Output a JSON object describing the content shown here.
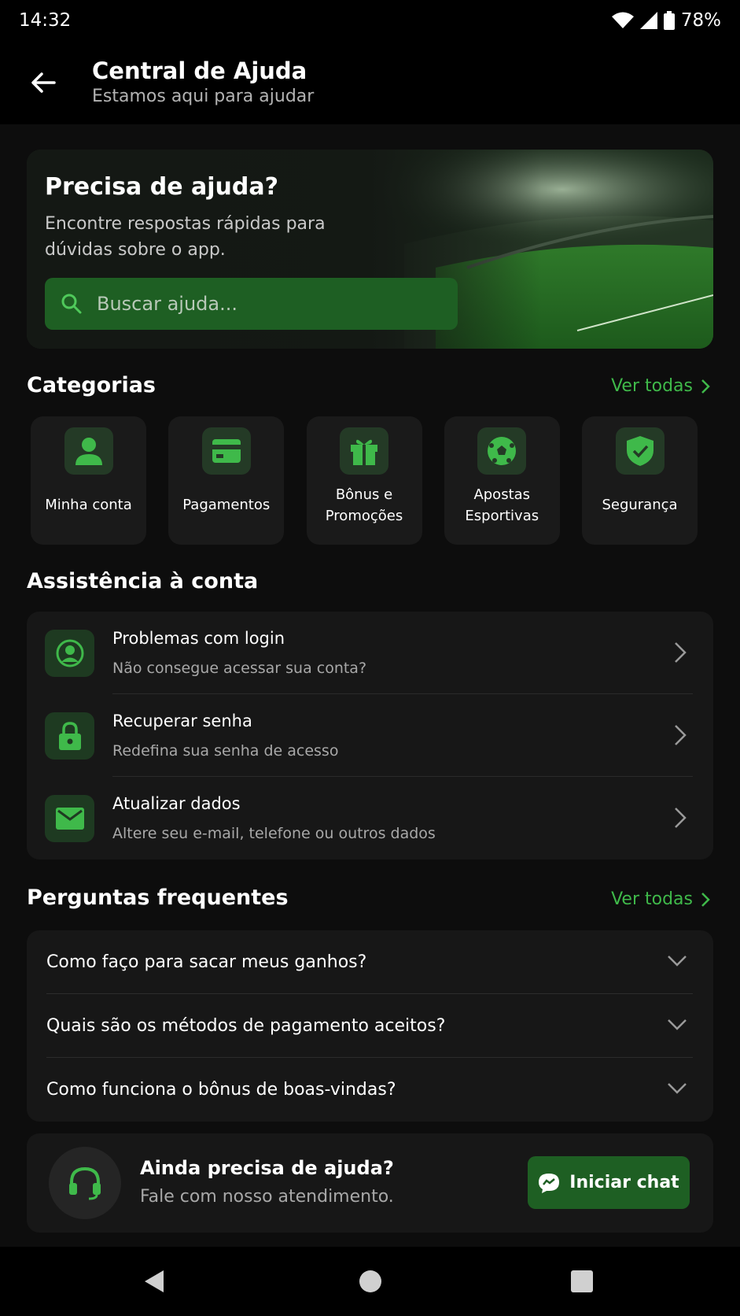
{
  "status": {
    "time": "14:32",
    "battery": "78%"
  },
  "header": {
    "title": "Central de Ajuda",
    "subtitle": "Estamos aqui para ajudar"
  },
  "hero": {
    "title": "Precisa de ajuda?",
    "text": "Encontre respostas rápidas para dúvidas sobre o app.",
    "search_placeholder": "Buscar ajuda..."
  },
  "categories": {
    "title": "Categorias",
    "see_all": "Ver todas",
    "items": [
      {
        "label": "Minha conta",
        "icon": "person-icon"
      },
      {
        "label": "Pagamentos",
        "icon": "card-icon"
      },
      {
        "label": "Bônus e Promoções",
        "icon": "gift-icon"
      },
      {
        "label": "Apostas Esportivas",
        "icon": "soccer-ball-icon"
      },
      {
        "label": "Segurança",
        "icon": "shield-check-icon"
      }
    ]
  },
  "account": {
    "title": "Assistência à conta",
    "items": [
      {
        "title": "Problemas com login",
        "subtitle": "Não consegue acessar sua conta?",
        "icon": "account-circle-icon"
      },
      {
        "title": "Recuperar senha",
        "subtitle": "Redefina sua senha de acesso",
        "icon": "lock-icon"
      },
      {
        "title": "Atualizar dados",
        "subtitle": "Altere seu e-mail, telefone ou outros dados",
        "icon": "mail-icon"
      }
    ]
  },
  "faq": {
    "title": "Perguntas frequentes",
    "see_all": "Ver todas",
    "items": [
      "Como faço para sacar meus ganhos?",
      "Quais são os métodos de pagamento aceitos?",
      "Como funciona o bônus de boas-vindas?"
    ]
  },
  "help": {
    "title": "Ainda precisa de ajuda?",
    "subtitle": "Fale com nosso atendimento.",
    "button": "Iniciar chat"
  },
  "colors": {
    "accent": "#3fb94a",
    "button_bg": "#1e5f23",
    "background": "#0d0d0d"
  }
}
